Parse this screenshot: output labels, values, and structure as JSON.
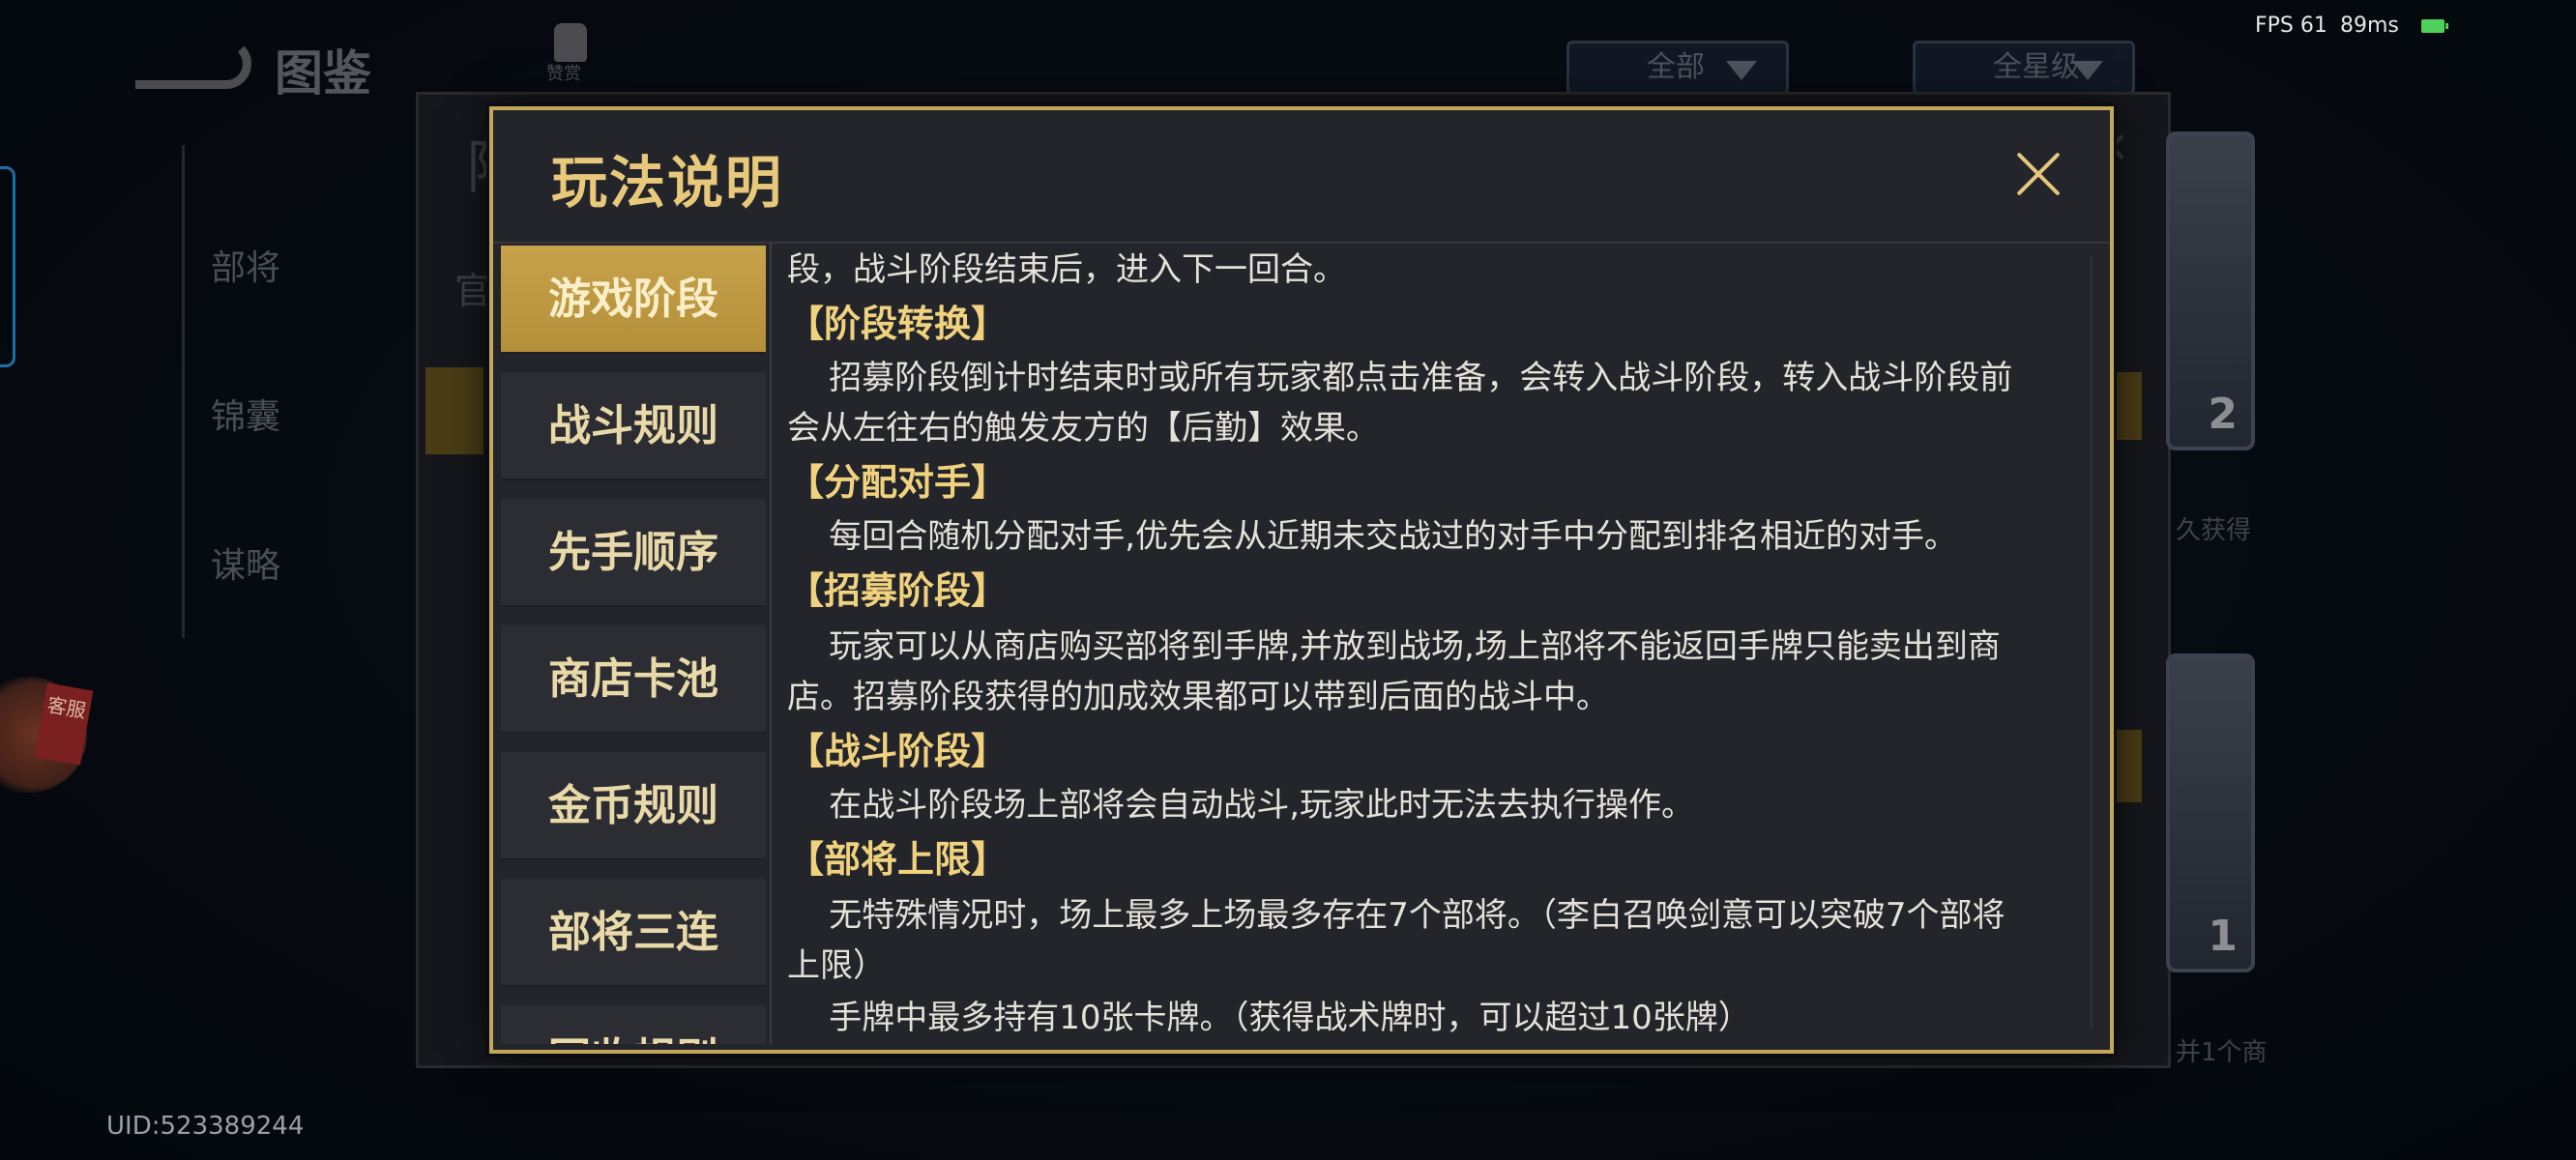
{
  "background": {
    "title": "图鉴",
    "like_label": "赞赏",
    "filter_all": "全部",
    "filter_star": "全星级",
    "fps": "FPS 61",
    "ping": "89ms",
    "side_items": [
      "部将",
      "锦囊",
      "谋略"
    ],
    "uid": "UID:523389244",
    "card_numbers": [
      "2",
      "1"
    ],
    "right_text_1": "久获得",
    "right_text_2": "并1个商",
    "outer_header_1": "官",
    "outer_header_2": "阵",
    "service_tag": "客服"
  },
  "modal": {
    "title": "玩法说明",
    "tabs": [
      {
        "label": "游戏阶段",
        "active": true
      },
      {
        "label": "战斗规则",
        "active": false
      },
      {
        "label": "先手顺序",
        "active": false
      },
      {
        "label": "商店卡池",
        "active": false
      },
      {
        "label": "金币规则",
        "active": false
      },
      {
        "label": "部将三连",
        "active": false
      },
      {
        "label": "回收规则",
        "active": false
      }
    ],
    "content": [
      {
        "type": "text",
        "text": "段，战斗阶段结束后，进入下一回合。"
      },
      {
        "type": "head",
        "text": "【阶段转换】"
      },
      {
        "type": "text",
        "text": "    招募阶段倒计时结束时或所有玩家都点击准备，会转入战斗阶段，转入战斗阶段前"
      },
      {
        "type": "text",
        "text": "会从左往右的触发友方的【后勤】效果。"
      },
      {
        "type": "head",
        "text": "【分配对手】"
      },
      {
        "type": "text",
        "text": "    每回合随机分配对手,优先会从近期未交战过的对手中分配到排名相近的对手。"
      },
      {
        "type": "head",
        "text": "【招募阶段】"
      },
      {
        "type": "text",
        "text": "    玩家可以从商店购买部将到手牌,并放到战场,场上部将不能返回手牌只能卖出到商"
      },
      {
        "type": "text",
        "text": "店。招募阶段获得的加成效果都可以带到后面的战斗中。"
      },
      {
        "type": "head",
        "text": "【战斗阶段】"
      },
      {
        "type": "text",
        "text": "    在战斗阶段场上部将会自动战斗,玩家此时无法去执行操作。"
      },
      {
        "type": "head",
        "text": "【部将上限】"
      },
      {
        "type": "text",
        "text": "    无特殊情况时，场上最多上场最多存在7个部将。（李白召唤剑意可以突破7个部将"
      },
      {
        "type": "text",
        "text": "上限）"
      },
      {
        "type": "text",
        "text": "    手牌中最多持有10张卡牌。（获得战术牌时，可以超过10张牌）"
      }
    ]
  },
  "colors": {
    "gold_border": "#c4a75b",
    "gold_title": "#e8c87a",
    "active_tab": "#c7a24b",
    "panel_bg": "#23252b"
  }
}
